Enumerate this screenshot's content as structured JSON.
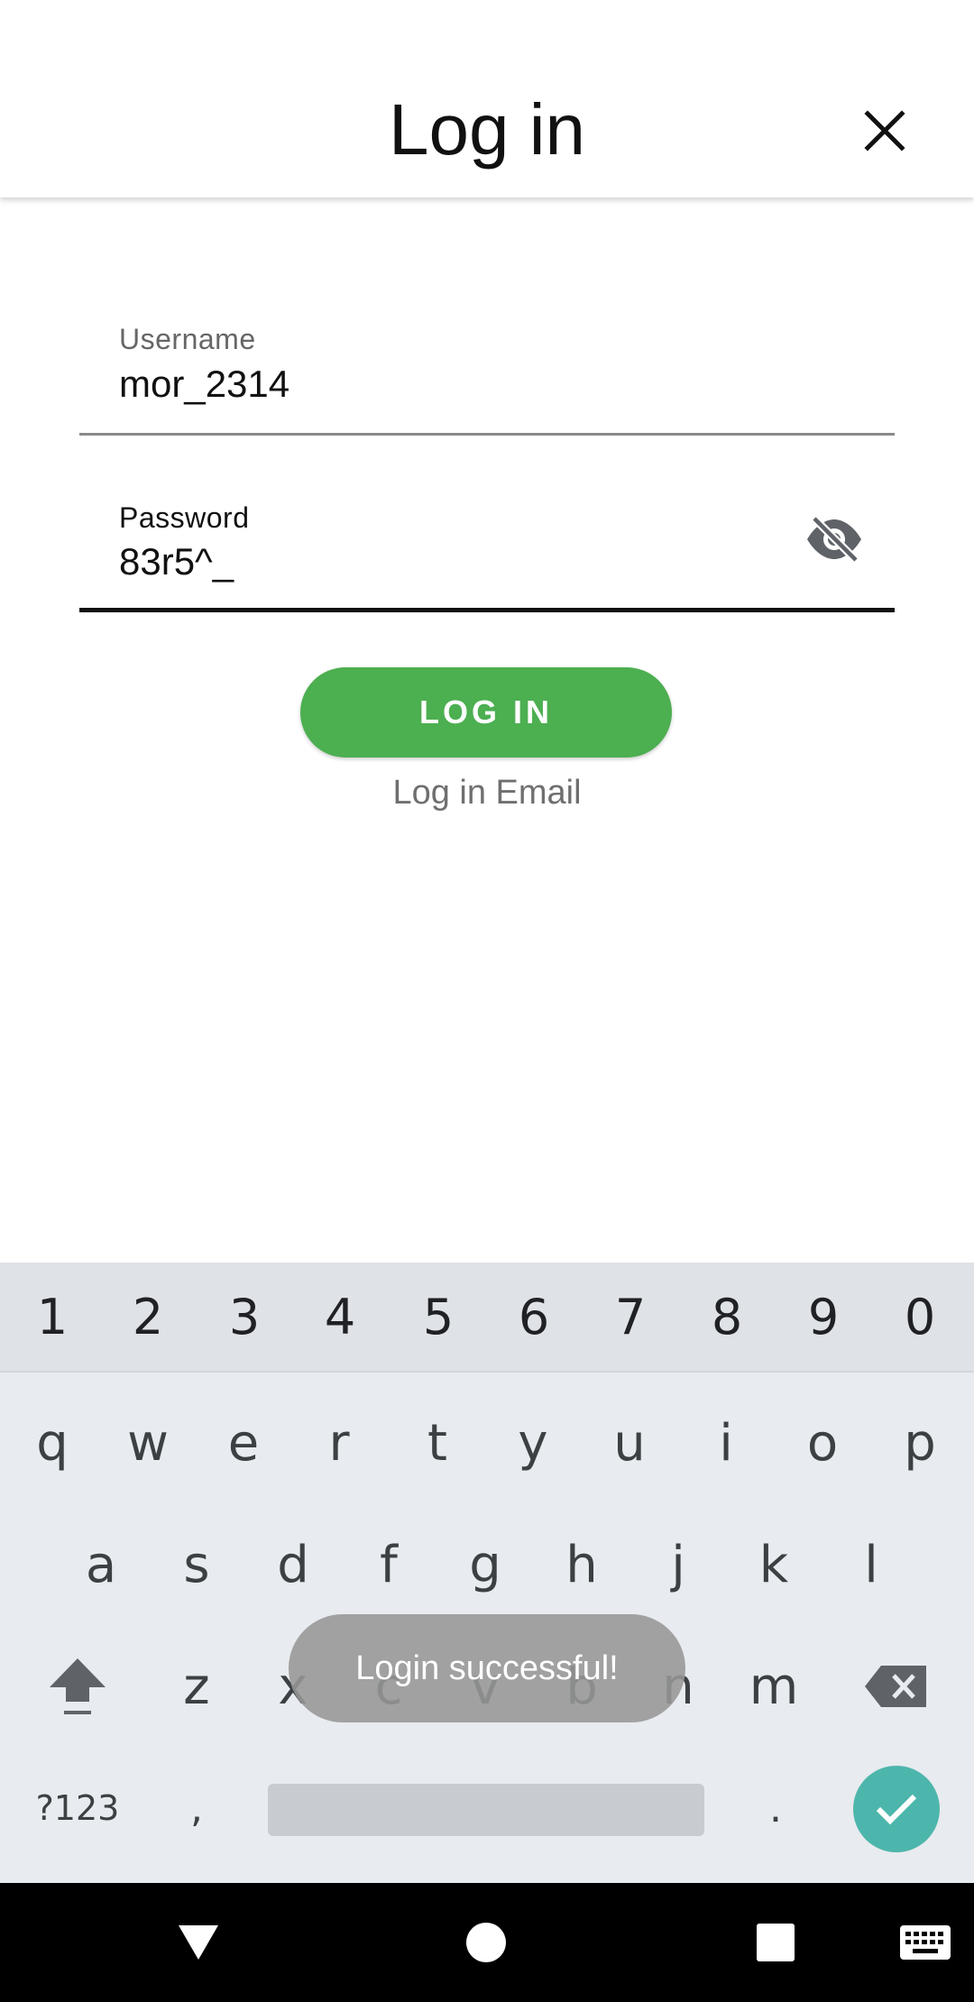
{
  "appbar": {
    "title": "Log in",
    "close_icon": "close-icon"
  },
  "form": {
    "username": {
      "label": "Username",
      "value": "mor_2314"
    },
    "password": {
      "label": "Password",
      "value": "83r5^_",
      "visibility_icon": "eye-off-icon"
    },
    "login_button": "LOG IN",
    "email_link": "Log in Email"
  },
  "toast": {
    "message": "Login successful!"
  },
  "keyboard": {
    "numbers": [
      "1",
      "2",
      "3",
      "4",
      "5",
      "6",
      "7",
      "8",
      "9",
      "0"
    ],
    "row1": [
      "q",
      "w",
      "e",
      "r",
      "t",
      "y",
      "u",
      "i",
      "o",
      "p"
    ],
    "row2": [
      "a",
      "s",
      "d",
      "f",
      "g",
      "h",
      "j",
      "k",
      "l"
    ],
    "row3": [
      "z",
      "x",
      "c",
      "v",
      "b",
      "n",
      "m"
    ],
    "symbols_key": "?123",
    "comma": ",",
    "period": ".",
    "shift_icon": "shift-icon",
    "backspace_icon": "backspace-icon",
    "enter_icon": "check-icon"
  },
  "navbar": {
    "back_icon": "back-icon",
    "home_icon": "home-icon",
    "recents_icon": "recents-icon",
    "keyboard_icon": "keyboard-switch-icon"
  },
  "colors": {
    "accent": "#4caf50",
    "enter": "#4db6ac",
    "toast": "#969696"
  }
}
